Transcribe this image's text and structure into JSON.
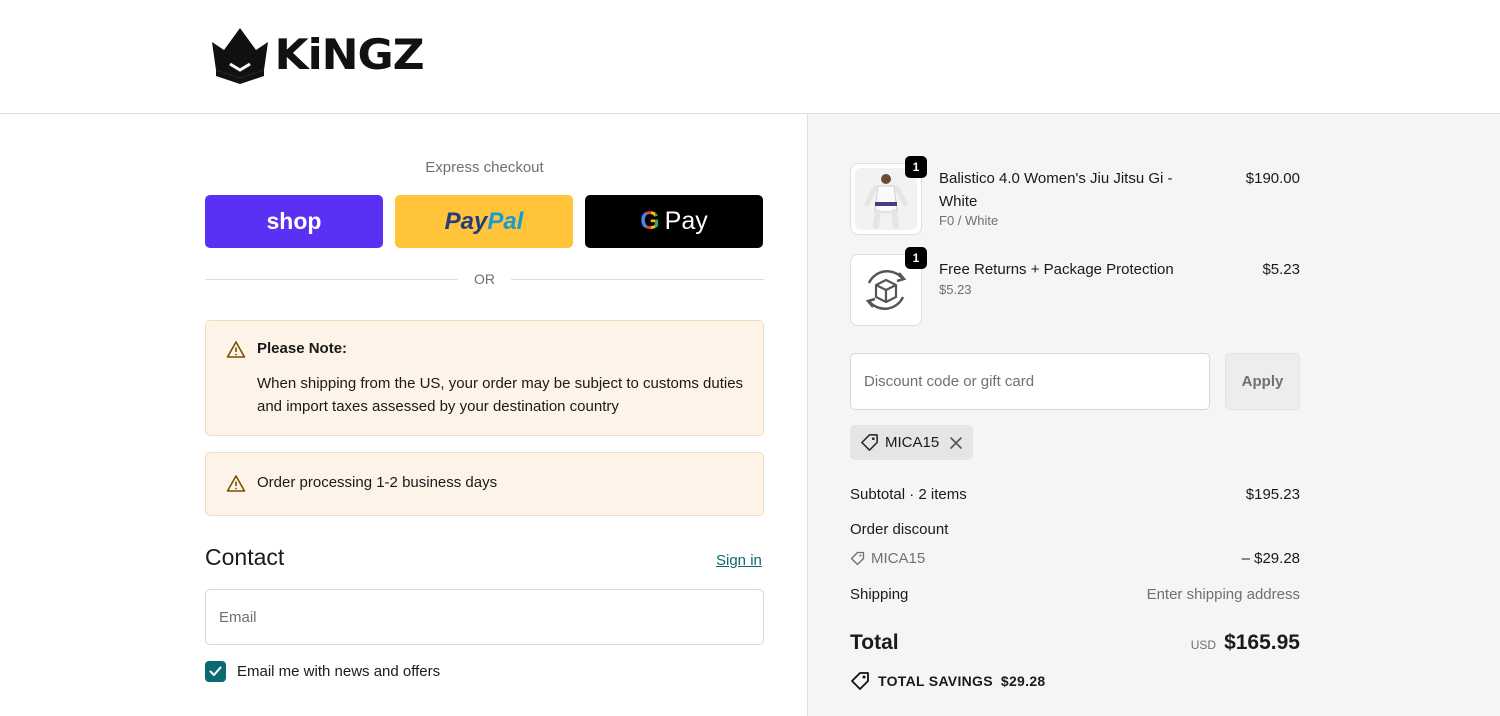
{
  "brand": {
    "name": "KiNGZ",
    "icon": "crown-logo-icon"
  },
  "express": {
    "title": "Express checkout",
    "shop_label": "shop",
    "paypal_part1": "Pay",
    "paypal_part2": "Pal",
    "gpay_label": "Pay",
    "or_text": "OR"
  },
  "notices": {
    "note_title": "Please Note:",
    "note_body": "When shipping from the US, your order may be subject to customs duties and import taxes assessed by your destination country",
    "processing": "Order processing 1-2 business days",
    "icon": "warning-triangle-icon"
  },
  "contact": {
    "title": "Contact",
    "sign_in": "Sign in",
    "email_placeholder": "Email",
    "newsletter_label": "Email me with news and offers",
    "newsletter_checked": true
  },
  "cart": {
    "items": [
      {
        "name": "Balistico 4.0 Women's Jiu Jitsu Gi - White",
        "variant": "F0 / White",
        "price": "$190.00",
        "qty": "1"
      },
      {
        "name": "Free Returns + Package Protection",
        "variant": "$5.23",
        "price": "$5.23",
        "qty": "1"
      }
    ],
    "discount_placeholder": "Discount code or gift card",
    "apply_label": "Apply",
    "applied_code": "MICA15"
  },
  "summary": {
    "subtotal_label": "Subtotal · 2 items",
    "subtotal_value": "$195.23",
    "discount_label": "Order discount",
    "discount_code": "MICA15",
    "discount_value": "– $29.28",
    "shipping_label": "Shipping",
    "shipping_value": "Enter shipping address",
    "total_label": "Total",
    "currency": "USD",
    "total_value": "$165.95",
    "savings_label": "TOTAL SAVINGS",
    "savings_value": "$29.28"
  },
  "colors": {
    "shop": "#5a31f4",
    "paypal": "#ffc439",
    "accent": "#0a6a72",
    "notice_bg": "#fdf3e8"
  }
}
